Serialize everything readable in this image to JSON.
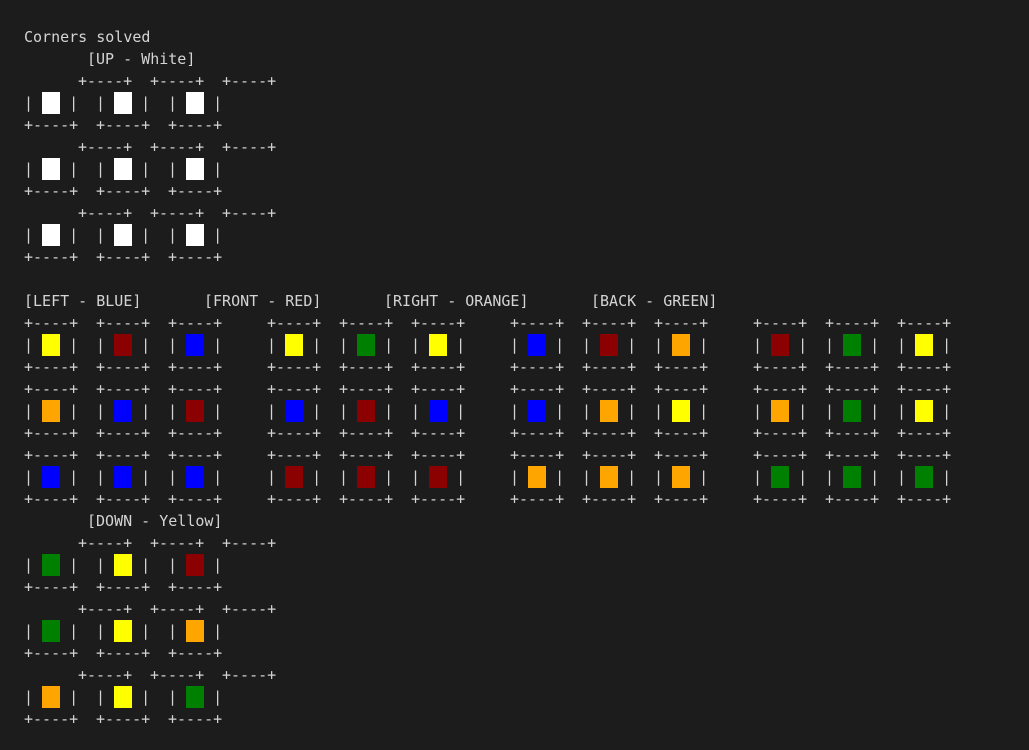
{
  "terminal": {
    "status_line": "Corners solved",
    "border_line": "+----+",
    "cell_line": "|    |"
  },
  "faces": {
    "up": {
      "label": "[UP - White]",
      "cells": [
        [
          "#ffffff",
          "#ffffff",
          "#ffffff"
        ],
        [
          "#ffffff",
          "#ffffff",
          "#ffffff"
        ],
        [
          "#ffffff",
          "#ffffff",
          "#ffffff"
        ]
      ]
    },
    "left": {
      "label": "[LEFT - BLUE]",
      "cells": [
        [
          "#ffff00",
          "#8b0000",
          "#0000ff"
        ],
        [
          "#ffa500",
          "#0000ff",
          "#8b0000"
        ],
        [
          "#0000ff",
          "#0000ff",
          "#0000ff"
        ]
      ]
    },
    "front": {
      "label": "[FRONT - RED]",
      "cells": [
        [
          "#ffff00",
          "#008000",
          "#ffff00"
        ],
        [
          "#0000ff",
          "#8b0000",
          "#0000ff"
        ],
        [
          "#8b0000",
          "#8b0000",
          "#8b0000"
        ]
      ]
    },
    "right": {
      "label": "[RIGHT - ORANGE]",
      "cells": [
        [
          "#0000ff",
          "#8b0000",
          "#ffa500"
        ],
        [
          "#0000ff",
          "#ffa500",
          "#ffff00"
        ],
        [
          "#ffa500",
          "#ffa500",
          "#ffa500"
        ]
      ]
    },
    "back": {
      "label": "[BACK - GREEN]",
      "cells": [
        [
          "#8b0000",
          "#008000",
          "#ffff00"
        ],
        [
          "#ffa500",
          "#008000",
          "#ffff00"
        ],
        [
          "#008000",
          "#008000",
          "#008000"
        ]
      ]
    },
    "down": {
      "label": "[DOWN - Yellow]",
      "cells": [
        [
          "#008000",
          "#ffff00",
          "#8b0000"
        ],
        [
          "#008000",
          "#ffff00",
          "#ffa500"
        ],
        [
          "#ffa500",
          "#ffff00",
          "#008000"
        ]
      ]
    }
  }
}
